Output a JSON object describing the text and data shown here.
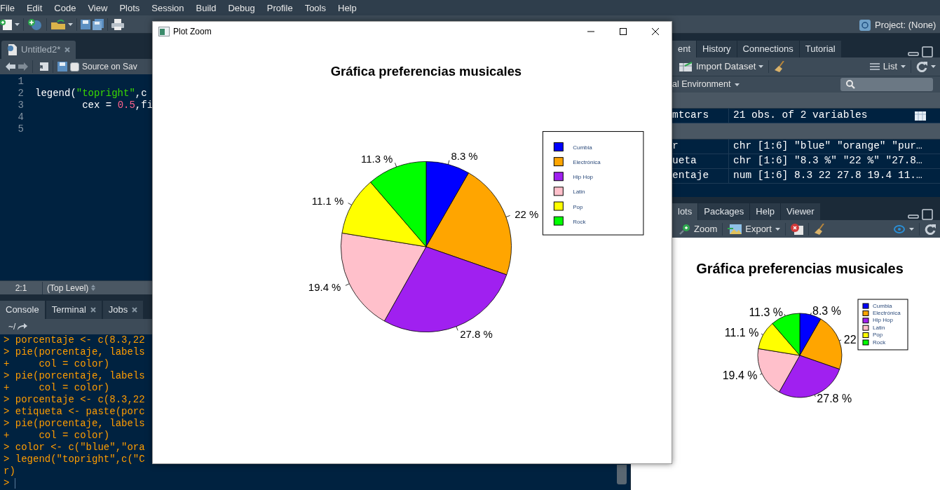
{
  "menu_bar": {
    "items": [
      "File",
      "Edit",
      "Code",
      "View",
      "Plots",
      "Session",
      "Build",
      "Debug",
      "Profile",
      "Tools",
      "Help"
    ]
  },
  "toolbar": {
    "project": "Project: (None)"
  },
  "editor": {
    "tabs": [
      {
        "label": "Untitled2*",
        "selected": true
      }
    ],
    "source_on_save": {
      "label": "Source on Sav",
      "checked": false
    },
    "lines": [
      {
        "number": "1"
      },
      {
        "number": "2",
        "tokens": [
          {
            "text": "legend(",
            "kind": "plain"
          },
          {
            "text": "\"topright\"",
            "kind": "string"
          },
          {
            "text": ",c",
            "kind": "plain"
          }
        ]
      },
      {
        "number": "3",
        "tokens": [
          {
            "text": "        cex = ",
            "kind": "plain"
          },
          {
            "text": "0.5",
            "kind": "number"
          },
          {
            "text": ",fi",
            "kind": "plain"
          }
        ]
      },
      {
        "number": "4"
      },
      {
        "number": "5"
      }
    ],
    "status": {
      "position": "2:1",
      "scope": "(Top Level)"
    }
  },
  "console": {
    "tabs": [
      {
        "label": "Console",
        "selected": true
      },
      {
        "label": "Terminal",
        "selected": false
      },
      {
        "label": "Jobs",
        "selected": false
      }
    ],
    "path": "~/",
    "lines": [
      "> porcentaje <- c(8.3,22",
      "> pie(porcentaje, labels",
      "+     col = color)",
      "> pie(porcentaje, labels",
      "+     col = color)",
      "> porcentaje <- c(8.3,22",
      "> etiqueta <- paste(porc",
      "> pie(porcentaje, labels",
      "+     col = color)",
      "> color <- c(\"blue\",\"ora",
      "> legend(\"topright\",c(\"C",
      "r)",
      ">"
    ]
  },
  "environment_pane": {
    "tabs": [
      {
        "label": "ent",
        "selected": true
      },
      {
        "label": "History",
        "selected": false
      },
      {
        "label": "Connections",
        "selected": false
      },
      {
        "label": "Tutorial",
        "selected": false
      }
    ],
    "import_button": "Import Dataset",
    "view_button": "List",
    "environment_menu": "al Environment",
    "data": [
      {
        "name": "mtcars",
        "value": "21 obs. of 2 variables"
      }
    ],
    "values": [
      {
        "name": "r",
        "value": "chr [1:6] \"blue\" \"orange\" \"pur…"
      },
      {
        "name": "ueta",
        "value": "chr [1:6] \"8.3 %\" \"22 %\" \"27.8…"
      },
      {
        "name": "entaje",
        "value": "num [1:6] 8.3 22 27.8 19.4 11.…"
      }
    ]
  },
  "plots_pane": {
    "tabs": [
      {
        "label": "lots",
        "selected": true
      },
      {
        "label": "Packages",
        "selected": false
      },
      {
        "label": "Help",
        "selected": false
      },
      {
        "label": "Viewer",
        "selected": false
      }
    ],
    "zoom_button": "Zoom",
    "export_button": "Export",
    "chart_data": {
      "type": "pie",
      "title": "Gráfica preferencias musicales",
      "categories": [
        "Cumbia",
        "Electrónica",
        "Hip Hop",
        "Latin",
        "Pop",
        "Rock"
      ],
      "values": [
        8.3,
        22,
        27.8,
        19.4,
        11.1,
        11.3
      ],
      "colors": [
        "#0000ff",
        "#ffa500",
        "#a020f0",
        "#ffc0cb",
        "#ffff00",
        "#00ff00"
      ],
      "value_labels": [
        "8.3 %",
        "22",
        "27.8 %",
        "19.4 %",
        "11.1 %",
        "11.3 %"
      ],
      "legend": "topright"
    }
  },
  "plot_zoom_window": {
    "title": "Plot Zoom",
    "chart_data": {
      "type": "pie",
      "title": "Gráfica preferencias musicales",
      "categories": [
        "Cumbia",
        "Electrónica",
        "Hip Hop",
        "Latin",
        "Pop",
        "Rock"
      ],
      "values": [
        8.3,
        22,
        27.8,
        19.4,
        11.1,
        11.3
      ],
      "colors": [
        "#0000ff",
        "#ffa500",
        "#a020f0",
        "#ffc0cb",
        "#ffff00",
        "#00ff00"
      ],
      "value_labels": [
        "8.3 %",
        "22 %",
        "27.8 %",
        "19.4 %",
        "11.1 %",
        "11.3 %"
      ],
      "legend": "topright"
    }
  }
}
